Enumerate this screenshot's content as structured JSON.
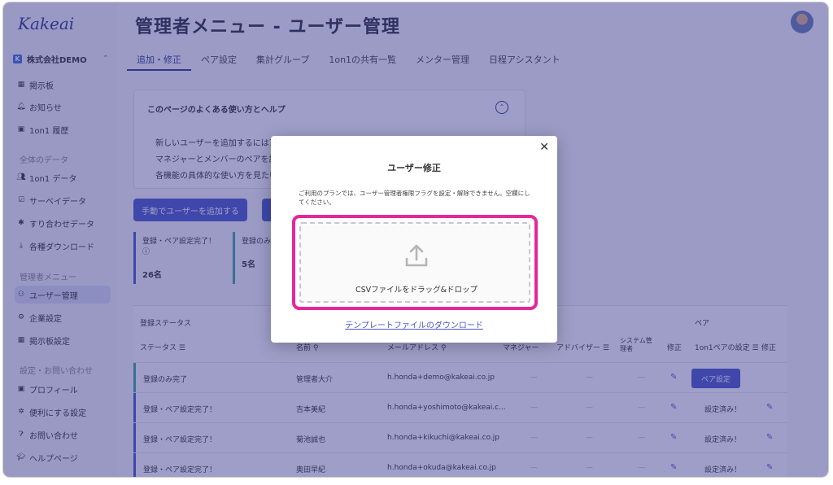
{
  "app": {
    "logo": "Kakeai"
  },
  "sidebar": {
    "company": "株式会社DEMO",
    "items": [
      {
        "label": "掲示板",
        "icon": "board-icon"
      },
      {
        "label": "お知らせ",
        "icon": "bell-icon"
      },
      {
        "label": "1on1 履歴",
        "icon": "history-icon"
      }
    ],
    "section_data": "全体のデータ",
    "data_items": [
      {
        "label": "1on1 データ"
      },
      {
        "label": "サーベイデータ"
      },
      {
        "label": "すり合わせデータ"
      },
      {
        "label": "各種ダウンロード"
      }
    ],
    "section_admin": "管理者メニュー",
    "admin_items": [
      {
        "label": "ユーザー管理"
      },
      {
        "label": "企業設定"
      },
      {
        "label": "掲示板設定"
      }
    ],
    "section_settings": "設定・お問い合わせ",
    "settings_items": [
      {
        "label": "プロフィール"
      },
      {
        "label": "便利にする設定"
      },
      {
        "label": "お問い合わせ"
      },
      {
        "label": "ヘルプページ"
      }
    ]
  },
  "header": {
    "title": "管理者メニュー - ユーザー管理"
  },
  "tabs": [
    "追加・修正",
    "ペア設定",
    "集計グループ",
    "1on1の共有一覧",
    "メンター管理",
    "日程アシスタント"
  ],
  "help": {
    "title": "このページのよくある使い方とヘルプ",
    "q1": "新しいユーザーを追加するには？",
    "q2": "マネジャーとメンバーのペアを設",
    "q3": "各機能の具体的な使い方を見たい"
  },
  "add_button": "手動でユーザーを追加する",
  "stats": [
    {
      "label": "登録・ペア設定完了！ ⓘ",
      "value": "26名"
    },
    {
      "label": "登録のみ完",
      "value": "5名"
    }
  ],
  "table": {
    "status_group": "登録ステータス",
    "pair_group": "ペア",
    "headers": {
      "status": "ステータス",
      "name": "名前",
      "email": "メールアドレス",
      "mentor": "マネジャー",
      "adviser": "アドバイザー",
      "system_admin": "システム管理者",
      "edit": "修正",
      "pair_setting": "1on1ペアの設定",
      "pair_edit": "修正"
    },
    "rows": [
      {
        "status": "登録のみ完了",
        "name": "管理者大介",
        "email": "h.honda+demo@kakeai.co.jp",
        "pair": "ペア設定"
      },
      {
        "status": "登録・ペア設定完了！",
        "name": "吉本美紀",
        "email": "h.honda+yoshimoto@kakeai.c...",
        "pair": "設定済み！"
      },
      {
        "status": "登録・ペア設定完了！",
        "name": "菊池誠也",
        "email": "h.honda+kikuchi@kakeai.co.jp",
        "pair": "設定済み！"
      },
      {
        "status": "登録・ペア設定完了！",
        "name": "奥田早紀",
        "email": "h.honda+okuda@kakeai.co.jp",
        "pair": "設定済み！"
      }
    ],
    "dash": "—"
  },
  "modal": {
    "title": "ユーザー修正",
    "note": "ご利用のプランでは、ユーザー管理者権限フラグを設定・解除できません。空欄にしてください。",
    "drop_text": "CSVファイルをドラッグ&ドロップ",
    "template_link": "テンプレートファイルのダウンロード",
    "close": "✕"
  },
  "colors": {
    "accent": "#4a58c8",
    "highlight": "#e5279a",
    "overlay": "#34348c"
  }
}
